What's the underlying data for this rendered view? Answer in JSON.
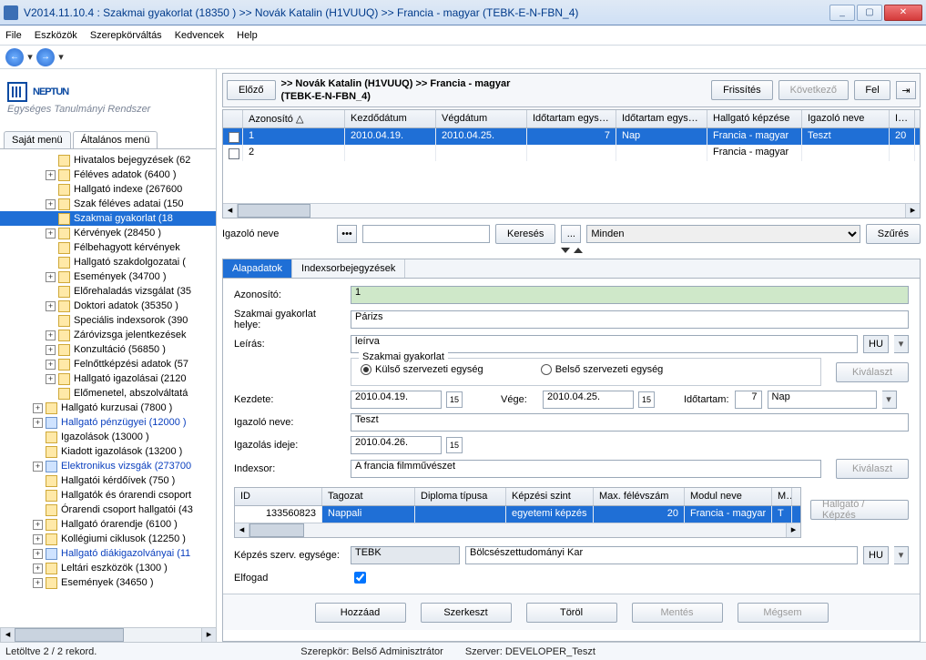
{
  "window": {
    "title": "V2014.11.10.4 : Szakmai gyakorlat (18350  )  >> Novák Katalin (H1VUUQ) >> Francia - magyar  (TEBK-E-N-FBN_4)"
  },
  "menu": {
    "items": [
      "File",
      "Eszközök",
      "Szerepkörváltás",
      "Kedvencek",
      "Help"
    ]
  },
  "logo": {
    "main": "NEPTUN",
    "sub": "Egységes Tanulmányi Rendszer"
  },
  "left_tabs": {
    "t1": "Saját menü",
    "t2": "Általános menü"
  },
  "tree": [
    {
      "l": 2,
      "exp": "",
      "label": "Hivatalos bejegyzések (62"
    },
    {
      "l": 2,
      "exp": "+",
      "label": "Féléves adatok (6400  )"
    },
    {
      "l": 2,
      "exp": "",
      "label": "Hallgató indexe (267600"
    },
    {
      "l": 2,
      "exp": "+",
      "label": "Szak féléves adatai (150"
    },
    {
      "l": 2,
      "exp": "",
      "label": "Szakmai gyakorlat (18",
      "sel": true
    },
    {
      "l": 2,
      "exp": "+",
      "label": "Kérvények (28450  )"
    },
    {
      "l": 2,
      "exp": "",
      "label": "Félbehagyott kérvények"
    },
    {
      "l": 2,
      "exp": "",
      "label": "Hallgató szakdolgozatai ("
    },
    {
      "l": 2,
      "exp": "+",
      "label": "Események (34700  )"
    },
    {
      "l": 2,
      "exp": "",
      "label": "Előrehaladás vizsgálat (35"
    },
    {
      "l": 2,
      "exp": "+",
      "label": "Doktori adatok (35350  )"
    },
    {
      "l": 2,
      "exp": "",
      "label": "Speciális indexsorok (390"
    },
    {
      "l": 2,
      "exp": "+",
      "label": "Záróvizsga jelentkezések"
    },
    {
      "l": 2,
      "exp": "+",
      "label": "Konzultáció (56850  )"
    },
    {
      "l": 2,
      "exp": "+",
      "label": "Felnőttképzési adatok (57"
    },
    {
      "l": 2,
      "exp": "+",
      "label": "Hallgató igazolásai (2120"
    },
    {
      "l": 2,
      "exp": "",
      "label": "Előmenetel, abszolváltatá"
    },
    {
      "l": 1,
      "exp": "+",
      "label": "Hallgató kurzusai (7800  )",
      "blue": false
    },
    {
      "l": 1,
      "exp": "+",
      "label": "Hallgató pénzügyei (12000  )",
      "blue": true
    },
    {
      "l": 1,
      "exp": "",
      "label": "Igazolások (13000  )"
    },
    {
      "l": 1,
      "exp": "",
      "label": "Kiadott igazolások (13200  )"
    },
    {
      "l": 1,
      "exp": "+",
      "label": "Elektronikus vizsgák (273700",
      "blue": true
    },
    {
      "l": 1,
      "exp": "",
      "label": "Hallgatói kérdőívek (750  )"
    },
    {
      "l": 1,
      "exp": "",
      "label": "Hallgatók és órarendi csoport"
    },
    {
      "l": 1,
      "exp": "",
      "label": "Órarendi csoport hallgatói (43"
    },
    {
      "l": 1,
      "exp": "+",
      "label": "Hallgató órarendje (6100  )"
    },
    {
      "l": 1,
      "exp": "+",
      "label": "Kollégiumi ciklusok (12250  )"
    },
    {
      "l": 1,
      "exp": "+",
      "label": "Hallgató diákigazolványai (11",
      "blue": true
    },
    {
      "l": 1,
      "exp": "+",
      "label": "Leltári eszközök (1300  )"
    },
    {
      "l": 1,
      "exp": "+",
      "label": "Események (34650  )"
    }
  ],
  "header": {
    "prev": "Előző",
    "crumb1": ">> Novák Katalin (H1VUUQ) >> Francia - magyar",
    "crumb2": "(TEBK-E-N-FBN_4)",
    "refresh": "Frissítés",
    "next": "Következő",
    "up": "Fel",
    "pin": "-⁋"
  },
  "grid": {
    "cols": [
      "",
      "Azonosító",
      "Kezdődátum",
      "Végdátum",
      "Időtartam egység ...",
      "Időtartam egysége",
      "Hallgató képzése",
      "Igazoló neve",
      "Iga"
    ],
    "rows": [
      {
        "sel": true,
        "cells": [
          "",
          "1",
          "2010.04.19.",
          "2010.04.25.",
          "7",
          "Nap",
          "Francia - magyar",
          "Teszt",
          "20"
        ]
      },
      {
        "sel": false,
        "cells": [
          "",
          "2",
          "",
          "",
          "",
          "",
          "Francia - magyar",
          "",
          ""
        ]
      }
    ]
  },
  "search": {
    "label": "Igazoló neve",
    "keres": "Keresés",
    "dots": "...",
    "combo": "Minden",
    "szures": "Szűrés"
  },
  "detail_tabs": {
    "t1": "Alapadatok",
    "t2": "Indexsorbejegyzések"
  },
  "form": {
    "azonosito_l": "Azonosító:",
    "azonosito_v": "1",
    "hely_l": "Szakmai gyakorlat helye:",
    "hely_v": "Párizs",
    "leiras_l": "Leírás:",
    "leiras_v": "leírva",
    "hu": "HU",
    "group_title": "Szakmai gyakorlat",
    "opt1": "Külső szervezeti egység",
    "opt2": "Belső szervezeti egység",
    "kivalaszt": "Kiválaszt",
    "kezdete_l": "Kezdete:",
    "kezdete_v": "2010.04.19.",
    "vege_l": "Vége:",
    "vege_v": "2010.04.25.",
    "idotartam_l": "Időtartam:",
    "idotartam_v": "7",
    "idotartam_unit": "Nap",
    "igazolo_l": "Igazoló neve:",
    "igazolo_v": "Teszt",
    "igazolasideje_l": "Igazolás ideje:",
    "igazolasideje_v": "2010.04.26.",
    "indexsor_l": "Indexsor:",
    "indexsor_v": "A francia filmművészet",
    "hallgato_kepzes": "Hallgató / Képzés"
  },
  "subgrid": {
    "cols": [
      "ID",
      "Tagozat",
      "Diploma típusa",
      "Képzési szint",
      "Max. félévszám",
      "Modul neve",
      "M"
    ],
    "row": [
      "133560823",
      "Nappali",
      "",
      "egyetemi képzés",
      "20",
      "Francia - magyar",
      "T"
    ]
  },
  "form2": {
    "kepzes_l": "Képzés szerv. egysége:",
    "kepzes_code": "TEBK",
    "kepzes_name": "Bölcsészettudományi Kar",
    "elfogad_l": "Elfogad"
  },
  "bottom": {
    "hozzaad": "Hozzáad",
    "szerkeszt": "Szerkeszt",
    "torol": "Töröl",
    "mentes": "Mentés",
    "megsem": "Mégsem"
  },
  "status": {
    "left": "Letöltve 2 / 2 rekord.",
    "role_l": "Szerepkör:",
    "role_v": "Belső Adminisztrátor",
    "srv_l": "Szerver:",
    "srv_v": "DEVELOPER_Teszt"
  }
}
